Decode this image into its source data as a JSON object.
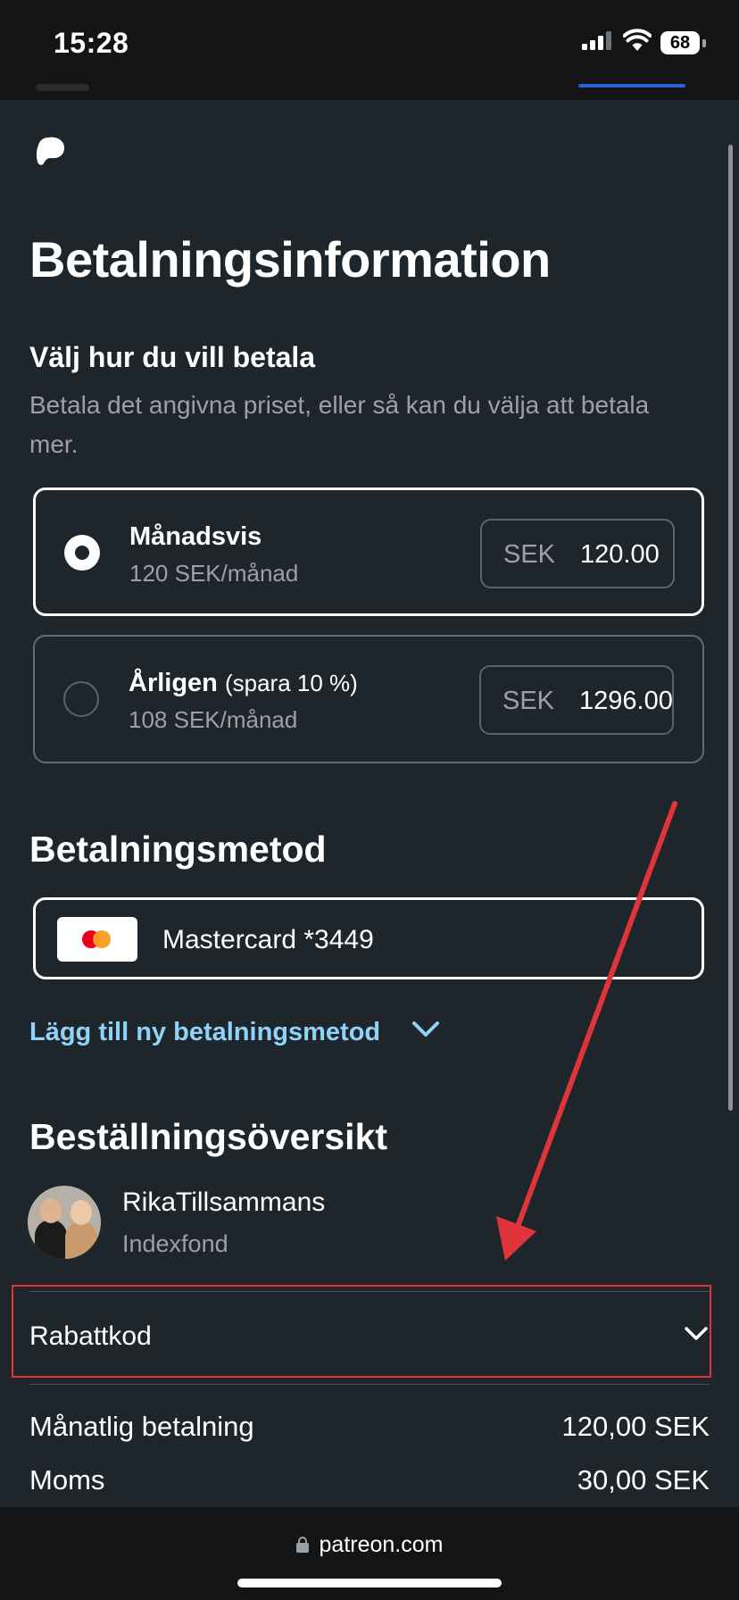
{
  "status_bar": {
    "time": "15:28",
    "battery": "68"
  },
  "page": {
    "title": "Betalningsinformation",
    "choose_heading": "Välj hur du vill betala",
    "choose_description": "Betala det angivna priset, eller så kan du välja att betala mer."
  },
  "billing_options": [
    {
      "title": "Månadsvis",
      "note": "",
      "subtitle": "120 SEK/månad",
      "currency": "SEK",
      "amount": "120.00",
      "selected": true
    },
    {
      "title": "Årligen",
      "note": "(spara 10 %)",
      "subtitle": "108 SEK/månad",
      "currency": "SEK",
      "amount": "1296.00",
      "selected": false
    }
  ],
  "payment_method": {
    "heading": "Betalningsmetod",
    "card_label": "Mastercard *3449",
    "add_link": "Lägg till ny betalningsmetod"
  },
  "order_summary": {
    "heading": "Beställningsöversikt",
    "creator_name": "RikaTillsammans",
    "tier": "Indexfond",
    "discount_label": "Rabattkod",
    "rows": [
      {
        "label": "Månatlig betalning",
        "value": "120,00 SEK"
      },
      {
        "label": "Moms",
        "value": "30,00 SEK"
      }
    ]
  },
  "browser": {
    "url": "patreon.com"
  },
  "colors": {
    "background": "#1e252b",
    "link": "#8fd3f8",
    "annotation_red": "#e0343b"
  }
}
